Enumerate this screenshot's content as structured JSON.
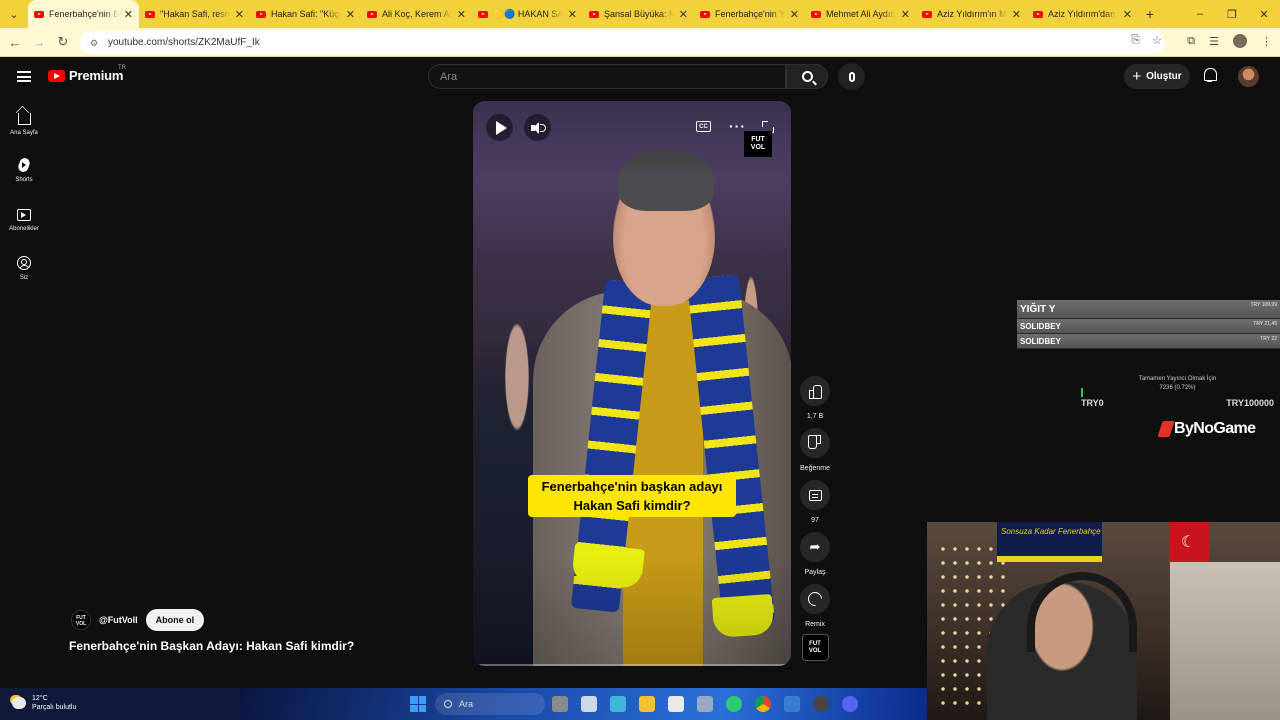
{
  "browser": {
    "tabs": [
      {
        "title": "Fenerbahçe'nin Ba",
        "active": true
      },
      {
        "title": "\"Hakan Safi, resmi",
        "active": false
      },
      {
        "title": "Hakan Safi: \"Küçü",
        "active": false
      },
      {
        "title": "Ali Koç, Kerem Ak",
        "active": false
      },
      {
        "title": "🟡🔵 HAKAN SA",
        "active": false
      },
      {
        "title": "Şansal Büyüka: M",
        "active": false
      },
      {
        "title": "Fenerbahçe'nin Ye",
        "active": false
      },
      {
        "title": "Mehmet Ali Aydın",
        "active": false
      },
      {
        "title": "Aziz Yıldırım'ın M",
        "active": false
      },
      {
        "title": "Aziz Yıldırım'dan",
        "active": false
      }
    ],
    "new_tab": "+",
    "url": "youtube.com/shorts/ZK2MaUfF_Ik",
    "window_controls": {
      "minimize": "–",
      "maximize": "❐",
      "close": "✕"
    }
  },
  "youtube": {
    "logo_text": "Premium",
    "region": "TR",
    "search_placeholder": "Ara",
    "create_label": "Oluştur",
    "sidebar": [
      {
        "label": "Ana Sayfa",
        "icon": "home-icon"
      },
      {
        "label": "Shorts",
        "icon": "shorts-icon"
      },
      {
        "label": "Abonelikler",
        "icon": "subscriptions-icon"
      },
      {
        "label": "Siz",
        "icon": "you-icon"
      }
    ],
    "video": {
      "caption_line1": "Fenerbahçe'nin başkan adayı",
      "caption_line2": "Hakan Safi kimdir?",
      "watermark_line1": "FUT",
      "watermark_line2": "VOL",
      "cc_label": "CC",
      "progress_fraction": 0.01
    },
    "actions": {
      "like_count": "1,7 B",
      "dislike_label": "Beğenme",
      "comment_count": "97",
      "share_label": "Paylaş",
      "remix_label": "Remix"
    },
    "channel": {
      "handle": "@FutVoll",
      "subscribe_label": "Abone ol"
    },
    "title": "Fenerbahçe'nin Başkan Adayı: Hakan Safi kimdir?"
  },
  "stream_overlay": {
    "donations": [
      {
        "name": "YIĞIT Y",
        "amount": "TRY 109,99"
      },
      {
        "name": "SOLIDBEY",
        "amount": "TRY 21,45"
      },
      {
        "name": "SOLIDBEY",
        "amount": "TRY 22"
      }
    ],
    "goal_title": "Tamamen Yayıncı Olmak İçin",
    "goal_progress": "7236 (0.72%)",
    "goal_fraction": 0.0072,
    "goal_min": "TRY0",
    "goal_max": "TRY100000",
    "sponsor": "ByNoGame",
    "webcam_banner": "Sonsuza Kadar Fenerbahçe"
  },
  "taskbar": {
    "temperature": "12°C",
    "weather": "Parçalı bulutlu",
    "search_placeholder": "Ara"
  }
}
